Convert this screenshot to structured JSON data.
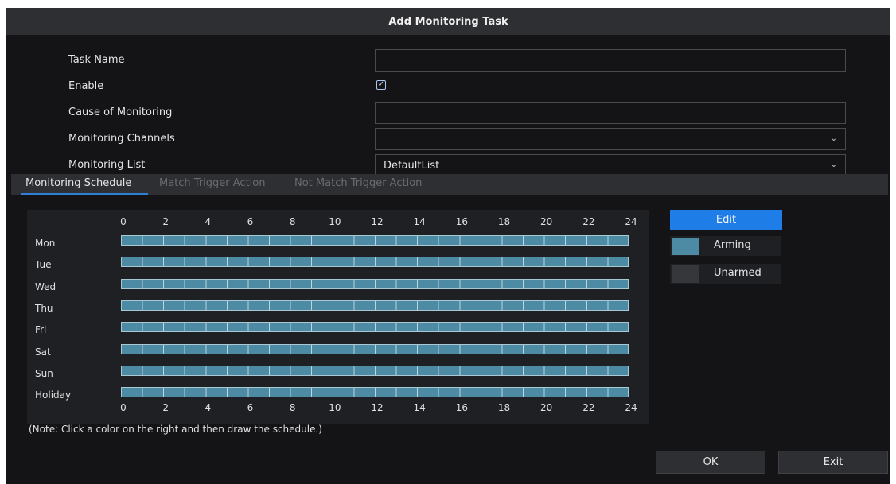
{
  "dialog": {
    "title": "Add Monitoring Task"
  },
  "form": {
    "task_name": {
      "label": "Task Name",
      "value": ""
    },
    "enable": {
      "label": "Enable",
      "checked": true
    },
    "cause": {
      "label": "Cause of Monitoring",
      "value": ""
    },
    "channels": {
      "label": "Monitoring Channels",
      "value": ""
    },
    "list": {
      "label": "Monitoring List",
      "value": "DefaultList"
    }
  },
  "tabs": [
    {
      "label": "Monitoring Schedule",
      "active": true
    },
    {
      "label": "Match Trigger Action",
      "active": false
    },
    {
      "label": "Not Match Trigger Action",
      "active": false
    }
  ],
  "schedule": {
    "hours": [
      "0",
      "2",
      "4",
      "6",
      "8",
      "10",
      "12",
      "14",
      "16",
      "18",
      "20",
      "22",
      "24"
    ],
    "days": [
      "Mon",
      "Tue",
      "Wed",
      "Thu",
      "Fri",
      "Sat",
      "Sun",
      "Holiday"
    ],
    "arming_color": "#4d8aa3",
    "unarmed_color": "#36373b"
  },
  "note": "(Note: Click a color on the right and then draw the schedule.)",
  "legend": {
    "edit_label": "Edit",
    "arming_label": "Arming",
    "unarmed_label": "Unarmed"
  },
  "buttons": {
    "ok": "OK",
    "exit": "Exit"
  },
  "icons": {
    "checkbox": "check-icon",
    "dropdown": "chevron-down-icon"
  }
}
